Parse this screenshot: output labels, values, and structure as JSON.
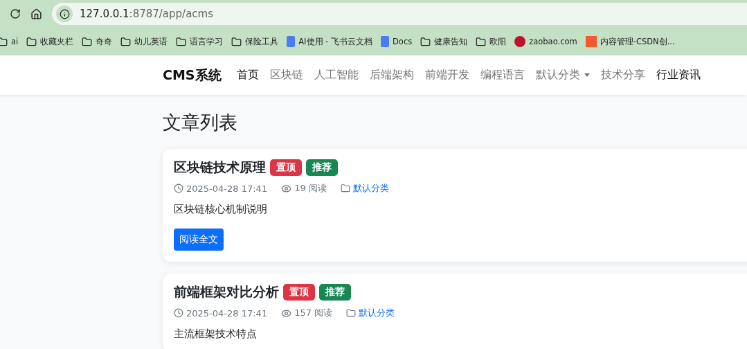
{
  "browser": {
    "address": {
      "host": "127.0.0.1",
      "path": ":8787/app/acms"
    },
    "bookmarks": [
      {
        "kind": "folder",
        "label": "ai"
      },
      {
        "kind": "folder",
        "label": "收藏夹栏"
      },
      {
        "kind": "folder",
        "label": "奇奇"
      },
      {
        "kind": "folder",
        "label": "幼儿英语"
      },
      {
        "kind": "folder",
        "label": "语言学习"
      },
      {
        "kind": "folder",
        "label": "保险工具"
      },
      {
        "kind": "doc",
        "label": "AI使用 - 飞书云文档"
      },
      {
        "kind": "doc",
        "label": "Docs"
      },
      {
        "kind": "folder",
        "label": "健康告知"
      },
      {
        "kind": "folder",
        "label": "欧阳"
      },
      {
        "kind": "round-logo",
        "label": "zaobao.com"
      },
      {
        "kind": "square-logo",
        "label": "内容管理-CSDN创..."
      }
    ]
  },
  "navbar": {
    "brand": "CMS系统",
    "items": [
      {
        "label": "首页",
        "selected": true,
        "dropdown": false
      },
      {
        "label": "区块链",
        "selected": false,
        "dropdown": false
      },
      {
        "label": "人工智能",
        "selected": false,
        "dropdown": false
      },
      {
        "label": "后端架构",
        "selected": false,
        "dropdown": false
      },
      {
        "label": "前端开发",
        "selected": false,
        "dropdown": false
      },
      {
        "label": "编程语言",
        "selected": false,
        "dropdown": false
      },
      {
        "label": "默认分类",
        "selected": false,
        "dropdown": true
      },
      {
        "label": "技术分享",
        "selected": false,
        "dropdown": false
      },
      {
        "label": "行业资讯",
        "selected": true,
        "dropdown": false
      }
    ]
  },
  "page_title": "文章列表",
  "articles": [
    {
      "title": "区块链技术原理",
      "badges": [
        {
          "label": "置顶",
          "color": "#dc3545"
        },
        {
          "label": "推荐",
          "color": "#198754"
        }
      ],
      "date": "2025-04-28 17:41",
      "views": "19 阅读",
      "category": "默认分类",
      "summary": "区块链核心机制说明",
      "button": "阅读全文"
    },
    {
      "title": "前端框架对比分析",
      "badges": [
        {
          "label": "置顶",
          "color": "#dc3545"
        },
        {
          "label": "推荐",
          "color": "#198754"
        }
      ],
      "date": "2025-04-28 17:41",
      "views": "157 阅读",
      "category": "默认分类",
      "summary": "主流框架技术特点"
    }
  ]
}
